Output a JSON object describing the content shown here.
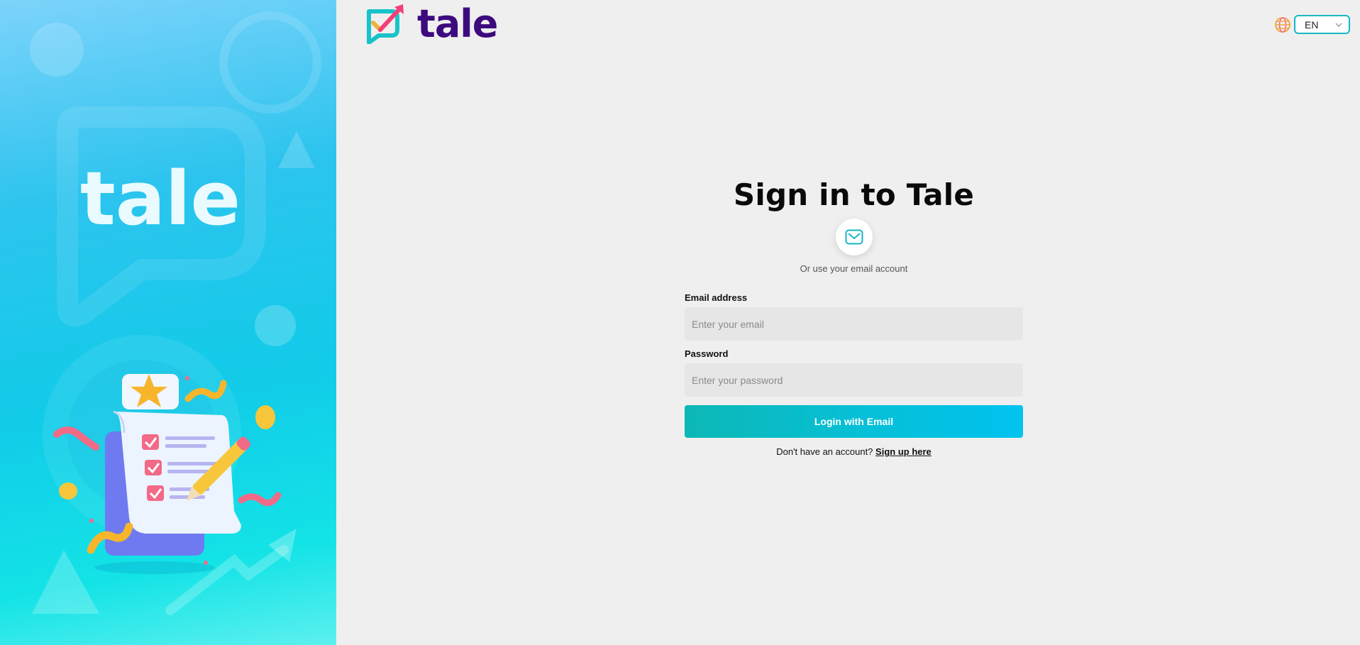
{
  "hero": {
    "brand_text": "tale"
  },
  "header": {
    "brand_text": "tale"
  },
  "language": {
    "selected": "EN"
  },
  "signin": {
    "title": "Sign in to Tale",
    "alt_text": "Or use your email account",
    "email_label": "Email address",
    "email_placeholder": "Enter your email",
    "email_value": "",
    "password_label": "Password",
    "password_placeholder": "Enter your password",
    "password_value": "",
    "login_button": "Login with Email",
    "signup_prompt": "Don't have an account?",
    "signup_link": "Sign up here"
  },
  "colors": {
    "brand_purple": "#3d0a7e",
    "accent_teal": "#17b8c2",
    "button_gradient_start": "#0cb8b5",
    "button_gradient_end": "#02c3ef",
    "page_bg": "#efefef"
  },
  "icons": {
    "logo": "checkmark-chat-bubble-icon",
    "globe": "globe-icon",
    "mail": "mail-icon",
    "chevron": "chevron-down-icon"
  }
}
